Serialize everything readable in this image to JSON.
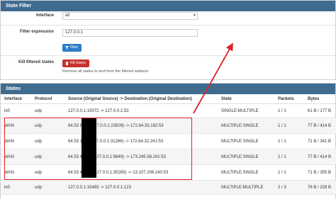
{
  "state_filter": {
    "title": "State Filter",
    "interface_label": "Interface",
    "interface_value": "all",
    "filter_expression_label": "Filter expression",
    "filter_expression_value": "127.0.0.1",
    "filter_button": "Filter",
    "kill_filtered_label": "Kill filtered states",
    "kill_button": "Kill States",
    "kill_help": "Remove all states to and from the filtered address"
  },
  "states": {
    "title": "States",
    "columns": [
      "Interface",
      "Protocol",
      "Source (Original Source) -> Destination (Original Destination)",
      "State",
      "Packets",
      "Bytes"
    ],
    "rows": [
      {
        "interface": "lo0",
        "protocol": "udp",
        "flow": "127.0.0.1:19372 -> 127.0.0.1:53",
        "state": "SINGLE:MULTIPLE",
        "packets": "1 / 1",
        "bytes": "61 B / 177 B"
      },
      {
        "interface": "WAN",
        "protocol": "udp",
        "flow": "64.53         8388 (127.0.0.1:23509) -> 172.64.33.182:53",
        "state": "MULTIPLE:SINGLE",
        "packets": "1 / 1",
        "bytes": "77 B / 414 B"
      },
      {
        "interface": "WAN",
        "protocol": "udp",
        "flow": "64.53         1195 (127.0.0.1:31266) -> 172.64.32.241:53",
        "state": "MULTIPLE:SINGLE",
        "packets": "1 / 1",
        "bytes": "71 B / 341 B"
      },
      {
        "interface": "WAN",
        "protocol": "udp",
        "flow": "64.53         44769 (127.0.0.1:9849) -> 173.245.58.241:53",
        "state": "MULTIPLE:SINGLE",
        "packets": "1 / 1",
        "bytes": "77 B / 414 B"
      },
      {
        "interface": "WAN",
        "protocol": "udp",
        "flow": "64.53         46719 (127.0.0.1:35265) -> 13.107.206.240:53",
        "state": "MULTIPLE:SINGLE",
        "packets": "1 / 1",
        "bytes": "71 B / 355 B"
      },
      {
        "interface": "lo0",
        "protocol": "udp",
        "flow": "127.0.0.1:15483 -> 127.0.0.1:123",
        "state": "MULTIPLE:MULTIPLE",
        "packets": "2 / 3",
        "bytes": "76 B / 228 B"
      }
    ]
  },
  "colors": {
    "heading": "#3f6b8f",
    "filter_button": "#2a7fc9",
    "kill_button": "#c9302c",
    "annotation": "#dd2222"
  }
}
